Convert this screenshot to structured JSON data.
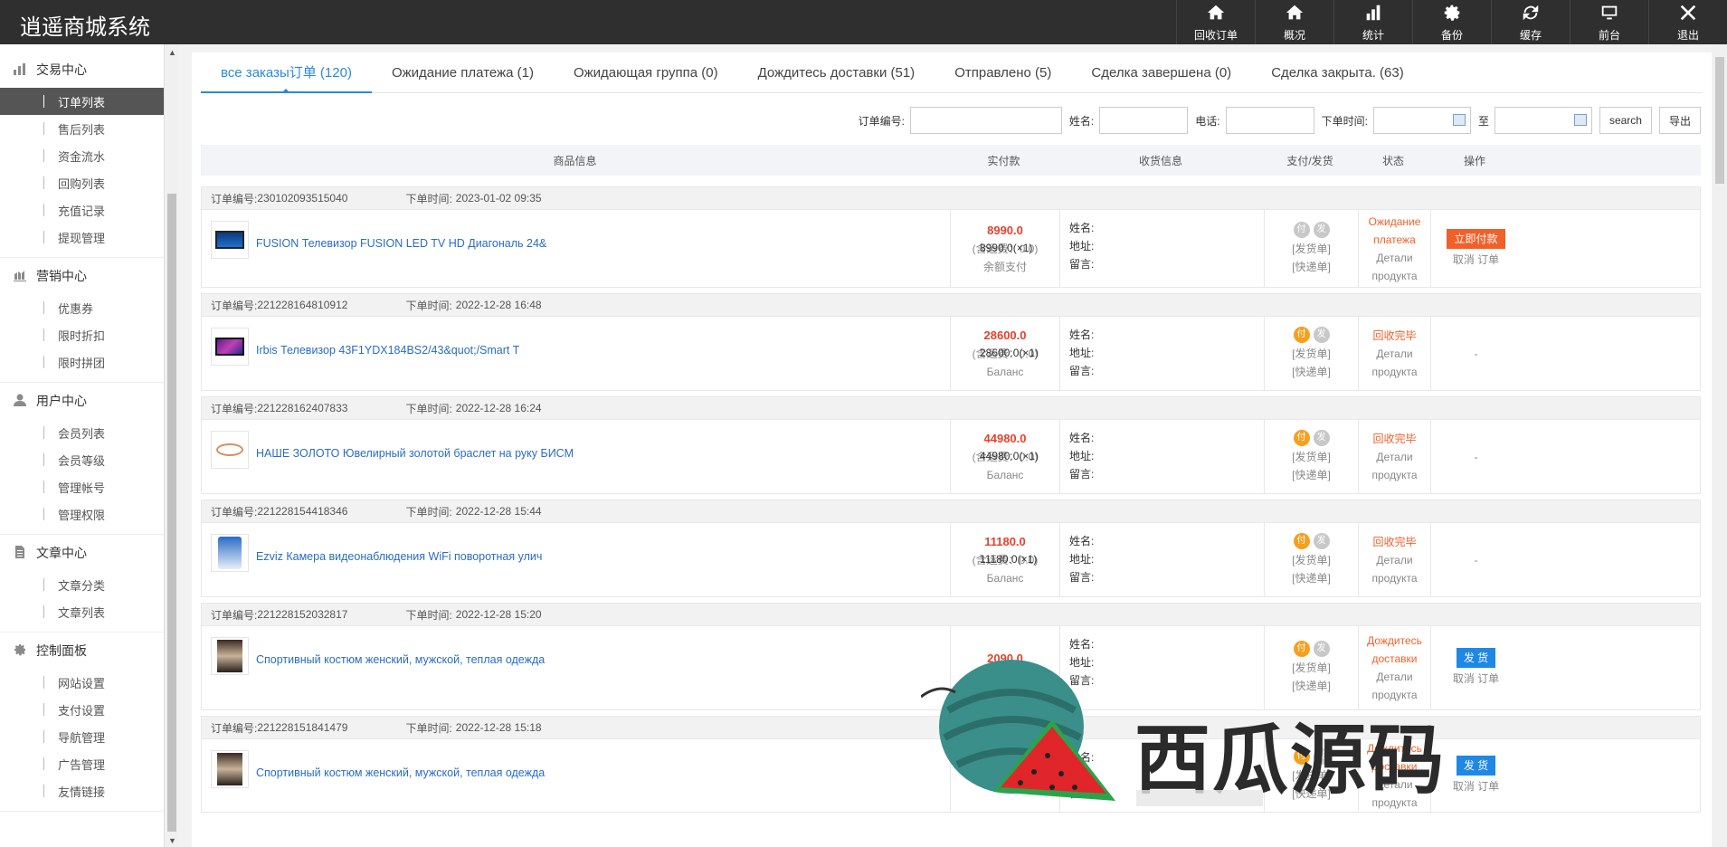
{
  "app": {
    "title": "逍遥商城系统"
  },
  "topnav": [
    {
      "label": "回收订单",
      "icon": "home-icon"
    },
    {
      "label": "概况",
      "icon": "home-icon"
    },
    {
      "label": "统计",
      "icon": "bar-chart-icon"
    },
    {
      "label": "备份",
      "icon": "gear-icon"
    },
    {
      "label": "缓存",
      "icon": "refresh-icon"
    },
    {
      "label": "前台",
      "icon": "monitor-icon"
    },
    {
      "label": "退出",
      "icon": "close-icon"
    }
  ],
  "sidebar": {
    "groups": [
      {
        "title": "交易中心",
        "icon": "chart-icon",
        "items": [
          "订单列表",
          "售后列表",
          "资金流水",
          "回购列表",
          "充值记录",
          "提现管理"
        ]
      },
      {
        "title": "营销中心",
        "icon": "marketing-icon",
        "items": [
          "优惠券",
          "限时折扣",
          "限时拼团"
        ]
      },
      {
        "title": "用户中心",
        "icon": "user-icon",
        "items": [
          "会员列表",
          "会员等级",
          "管理帐号",
          "管理权限"
        ]
      },
      {
        "title": "文章中心",
        "icon": "document-icon",
        "items": [
          "文章分类",
          "文章列表"
        ]
      },
      {
        "title": "控制面板",
        "icon": "gear-icon",
        "items": [
          "网站设置",
          "支付设置",
          "导航管理",
          "广告管理",
          "友情链接"
        ]
      }
    ],
    "active_item": "订单列表"
  },
  "tabs": [
    "все заказы订单 (120)",
    "Ожидание платежа (1)",
    "Ожидающая группа (0)",
    "Дождитесь доставки (51)",
    "Отправлено (5)",
    "Сделка завершена (0)",
    "Сделка закрыта. (63)"
  ],
  "filters": {
    "order_no_label": "订单编号:",
    "name_label": "姓名:",
    "phone_label": "电话:",
    "time_label": "下单时间:",
    "to_label": "至",
    "search_label": "search",
    "export_label": "导出"
  },
  "table_headers": [
    "商品信息",
    "实付款",
    "收货信息",
    "支付/发货",
    "状态",
    "操作"
  ],
  "order_labels": {
    "order_no": "订单编号:",
    "order_time": "下单时间:",
    "tax": "(含运费：0.0)",
    "name": "姓名:",
    "addr": "地址:",
    "msg": "留言:",
    "pay_badge": "付",
    "ship_badge": "发",
    "ship_note": "[发货单]",
    "express_note": "[快递单]",
    "details": "Детали продукта"
  },
  "orders": [
    {
      "no": "230102093515040",
      "time": "2023-01-02 09:35",
      "name": "FUSION Телевизор FUSION LED TV HD Диагональ 24&",
      "price": "8990.0(×1)",
      "amount": "8990.0",
      "method": "余额支付",
      "paid": false,
      "status": "Ожидание платежа",
      "op_button": "立即付款",
      "op_color": "red",
      "op_link": "取消 订单",
      "thumb": "tv-blue"
    },
    {
      "no": "221228164810912",
      "time": "2022-12-28 16:48",
      "name": "Irbis Телевизор 43F1YDX184BS2/43&quot;/Smart T",
      "price": "28600.0(×1)",
      "amount": "28600.0",
      "method": "Баланс",
      "paid": true,
      "status": "回收完毕",
      "op_button": "",
      "op_color": "",
      "op_link": "-",
      "thumb": "tv-purple"
    },
    {
      "no": "221228162407833",
      "time": "2022-12-28 16:24",
      "name": "НАШЕ ЗОЛОТО Ювелирный золотой браслет на руку БИСМ",
      "price": "44980.0(×1)",
      "amount": "44980.0",
      "method": "Баланс",
      "paid": true,
      "status": "回收完毕",
      "op_button": "",
      "op_color": "",
      "op_link": "-",
      "thumb": "bracelet"
    },
    {
      "no": "221228154418346",
      "time": "2022-12-28 15:44",
      "name": "Ezviz Камера видеонаблюдения WiFi поворотная улич",
      "price": "11180.0(×1)",
      "amount": "11180.0",
      "method": "Баланс",
      "paid": true,
      "status": "回收完毕",
      "op_button": "",
      "op_color": "",
      "op_link": "-",
      "thumb": "camera"
    },
    {
      "no": "221228152032817",
      "time": "2022-12-28 15:20",
      "name": "Спортивный костюм женский, мужской, теплая одежда",
      "price": "",
      "amount": "2090.0",
      "method": "",
      "paid": true,
      "status": "Дождитесь доставки",
      "op_button": "发 货",
      "op_color": "blue",
      "op_link": "取消 订单",
      "thumb": "clothes"
    },
    {
      "no": "221228151841479",
      "time": "2022-12-28 15:18",
      "name": "Спортивный костюм женский, мужской, теплая одежда",
      "price": "2090.0(×1)",
      "amount": "",
      "method": "Баланс",
      "paid": true,
      "status": "Дождитесь доставки",
      "op_button": "发 货",
      "op_color": "blue",
      "op_link": "取消 订单",
      "thumb": "clothes"
    }
  ],
  "watermark": {
    "text": "西瓜源码"
  },
  "colors": {
    "topbar": "#2f2f2f",
    "accent": "#2a8ad8",
    "price": "#e4422c",
    "status": "#f2602a"
  }
}
